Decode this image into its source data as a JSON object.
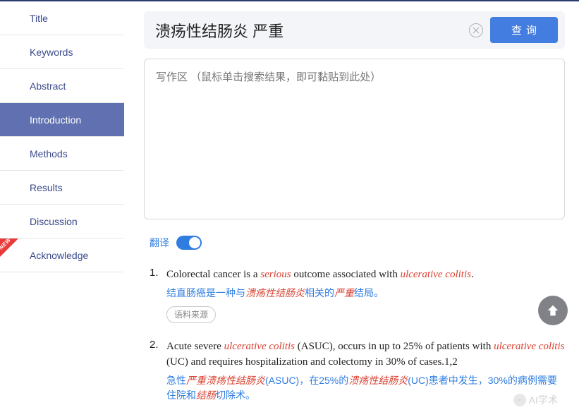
{
  "sidebar": {
    "items": [
      {
        "label": "Title"
      },
      {
        "label": "Keywords"
      },
      {
        "label": "Abstract"
      },
      {
        "label": "Introduction"
      },
      {
        "label": "Methods"
      },
      {
        "label": "Results"
      },
      {
        "label": "Discussion"
      },
      {
        "label": "Acknowledge"
      }
    ],
    "active_index": 3,
    "new_badge_index": 7,
    "new_badge_text": "NEW"
  },
  "search": {
    "value": "溃疡性结肠炎 严重",
    "query_button": "查询"
  },
  "writing_area": {
    "placeholder": "写作区 （鼠标单击搜索结果，即可黏贴到此处）"
  },
  "translate": {
    "label": "翻译",
    "enabled": true
  },
  "results": [
    {
      "num": "1.",
      "en_parts": [
        "Colorectal cancer is a ",
        "serious",
        " outcome associated with ",
        "ulcerative colitis",
        "."
      ],
      "zh_parts": [
        "结直肠癌是一种与",
        "溃疡性结肠炎",
        "相关的",
        "严重",
        "结局。"
      ],
      "source_label": "语料来源"
    },
    {
      "num": "2.",
      "en_parts": [
        "Acute severe ",
        "ulcerative colitis",
        " (ASUC), occurs in up to 25% of patients with ",
        "ulcerative colitis",
        " (UC) and requires hospitalization and colectomy in 30% of cases.1,2"
      ],
      "zh_parts": [
        "急性",
        "严重溃疡性结肠炎",
        "(ASUC)，在25%的",
        "溃疡性结肠炎",
        "(UC)患者中发生，30%的病例需要住院和",
        "结肠",
        "切除术。"
      ]
    }
  ],
  "watermark": "AI学术"
}
